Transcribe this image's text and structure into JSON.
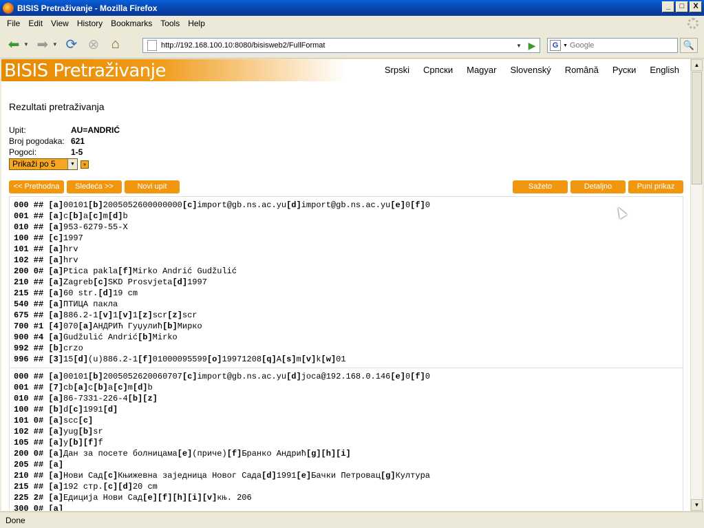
{
  "window": {
    "title": "BISIS Pretraživanje - Mozilla Firefox",
    "buttons": [
      "_",
      "□",
      "X"
    ]
  },
  "menu": [
    {
      "label": "File"
    },
    {
      "label": "Edit"
    },
    {
      "label": "View"
    },
    {
      "label": "History"
    },
    {
      "label": "Bookmarks"
    },
    {
      "label": "Tools"
    },
    {
      "label": "Help"
    }
  ],
  "navbar": {
    "url": "http://192.168.100.10:8080/bisisweb2/FullFormat",
    "search_placeholder": "Google"
  },
  "page": {
    "logo": "BISIS Pretraživanje",
    "languages": [
      "Srpski",
      "Српски",
      "Magyar",
      "Slovenský",
      "Română",
      "Руски",
      "English"
    ],
    "heading": "Rezultati pretraživanja",
    "query_label": "Upit:",
    "query_value": "AU=ANDRIĆ",
    "count_label": "Broj pogodaka:",
    "count_value": "621",
    "hits_label": "Pogoci:",
    "hits_value": "1-5",
    "show_select": "Prikaži po 5",
    "buttons": {
      "prev": "<< Prethodna",
      "next": "Sledeća >>",
      "new_query": "Novi upit",
      "short": "Sažeto",
      "detailed": "Detaljno",
      "full": "Puni prikaz"
    },
    "records": [
      {
        "lines": [
          [
            "000 ##",
            "[a]00101[b]2005052600000000[c]import@gb.ns.ac.yu[d]import@gb.ns.ac.yu[e]0[f]0"
          ],
          [
            "001 ##",
            "[a]c[b]a[c]m[d]b"
          ],
          [
            "010 ##",
            "[a]953-6279-55-X"
          ],
          [
            "100 ##",
            "[c]1997"
          ],
          [
            "101 ##",
            "[a]hrv"
          ],
          [
            "102 ##",
            "[a]hrv"
          ],
          [
            "200 0#",
            "[a]Ptica pakla[f]Mirko Andrić Gudžulić"
          ],
          [
            "210 ##",
            "[a]Zagreb[c]SKD Prosvjeta[d]1997"
          ],
          [
            "215 ##",
            "[a]60 str.[d]19 cm"
          ],
          [
            "540 ##",
            "[a]ПТИЦА пакла"
          ],
          [
            "675 ##",
            "[a]886.2-1[v]1[v]1[z]scr[z]scr"
          ],
          [
            "700 #1",
            "[4]070[a]АНДРИЋ Гуџулић[b]Мирко"
          ],
          [
            "900 #4",
            "[a]Gudžulić Andrić[b]Mirko"
          ],
          [
            "992 ##",
            "[b]crzo"
          ],
          [
            "996 ##",
            "[3]15[d](u)886.2-1[f]01000095599[o]19971208[q]A[s]m[v]k[w]01"
          ]
        ]
      },
      {
        "lines": [
          [
            "000 ##",
            "[a]00101[b]2005052620060707[c]import@gb.ns.ac.yu[d]joca@192.168.0.146[e]0[f]0"
          ],
          [
            "001 ##",
            "[7]cb[a]c[b]a[c]m[d]b"
          ],
          [
            "010 ##",
            "[a]86-7331-226-4[b][z]"
          ],
          [
            "100 ##",
            "[b]d[c]1991[d]"
          ],
          [
            "101 0#",
            "[a]scc[c]"
          ],
          [
            "102 ##",
            "[a]yug[b]sr"
          ],
          [
            "105 ##",
            "[a]y[b][f]f"
          ],
          [
            "200 0#",
            "[a]Дан за посете болницама[e](приче)[f]Бранко Андрић[g][h][i]"
          ],
          [
            "205 ##",
            "[a]"
          ],
          [
            "210 ##",
            "[a]Нови Сад[c]Књижевна заједница Новог Сада[d]1991[e]Бачки Петровац[g]Култура"
          ],
          [
            "215 ##",
            "[a]192 стр.[c][d]20 cm"
          ],
          [
            "225 2#",
            "[a]Едиција Нови Сад[e][f][h][i][v]књ. 206"
          ],
          [
            "300 0#",
            "[a]"
          ]
        ]
      }
    ]
  },
  "status": "Done"
}
